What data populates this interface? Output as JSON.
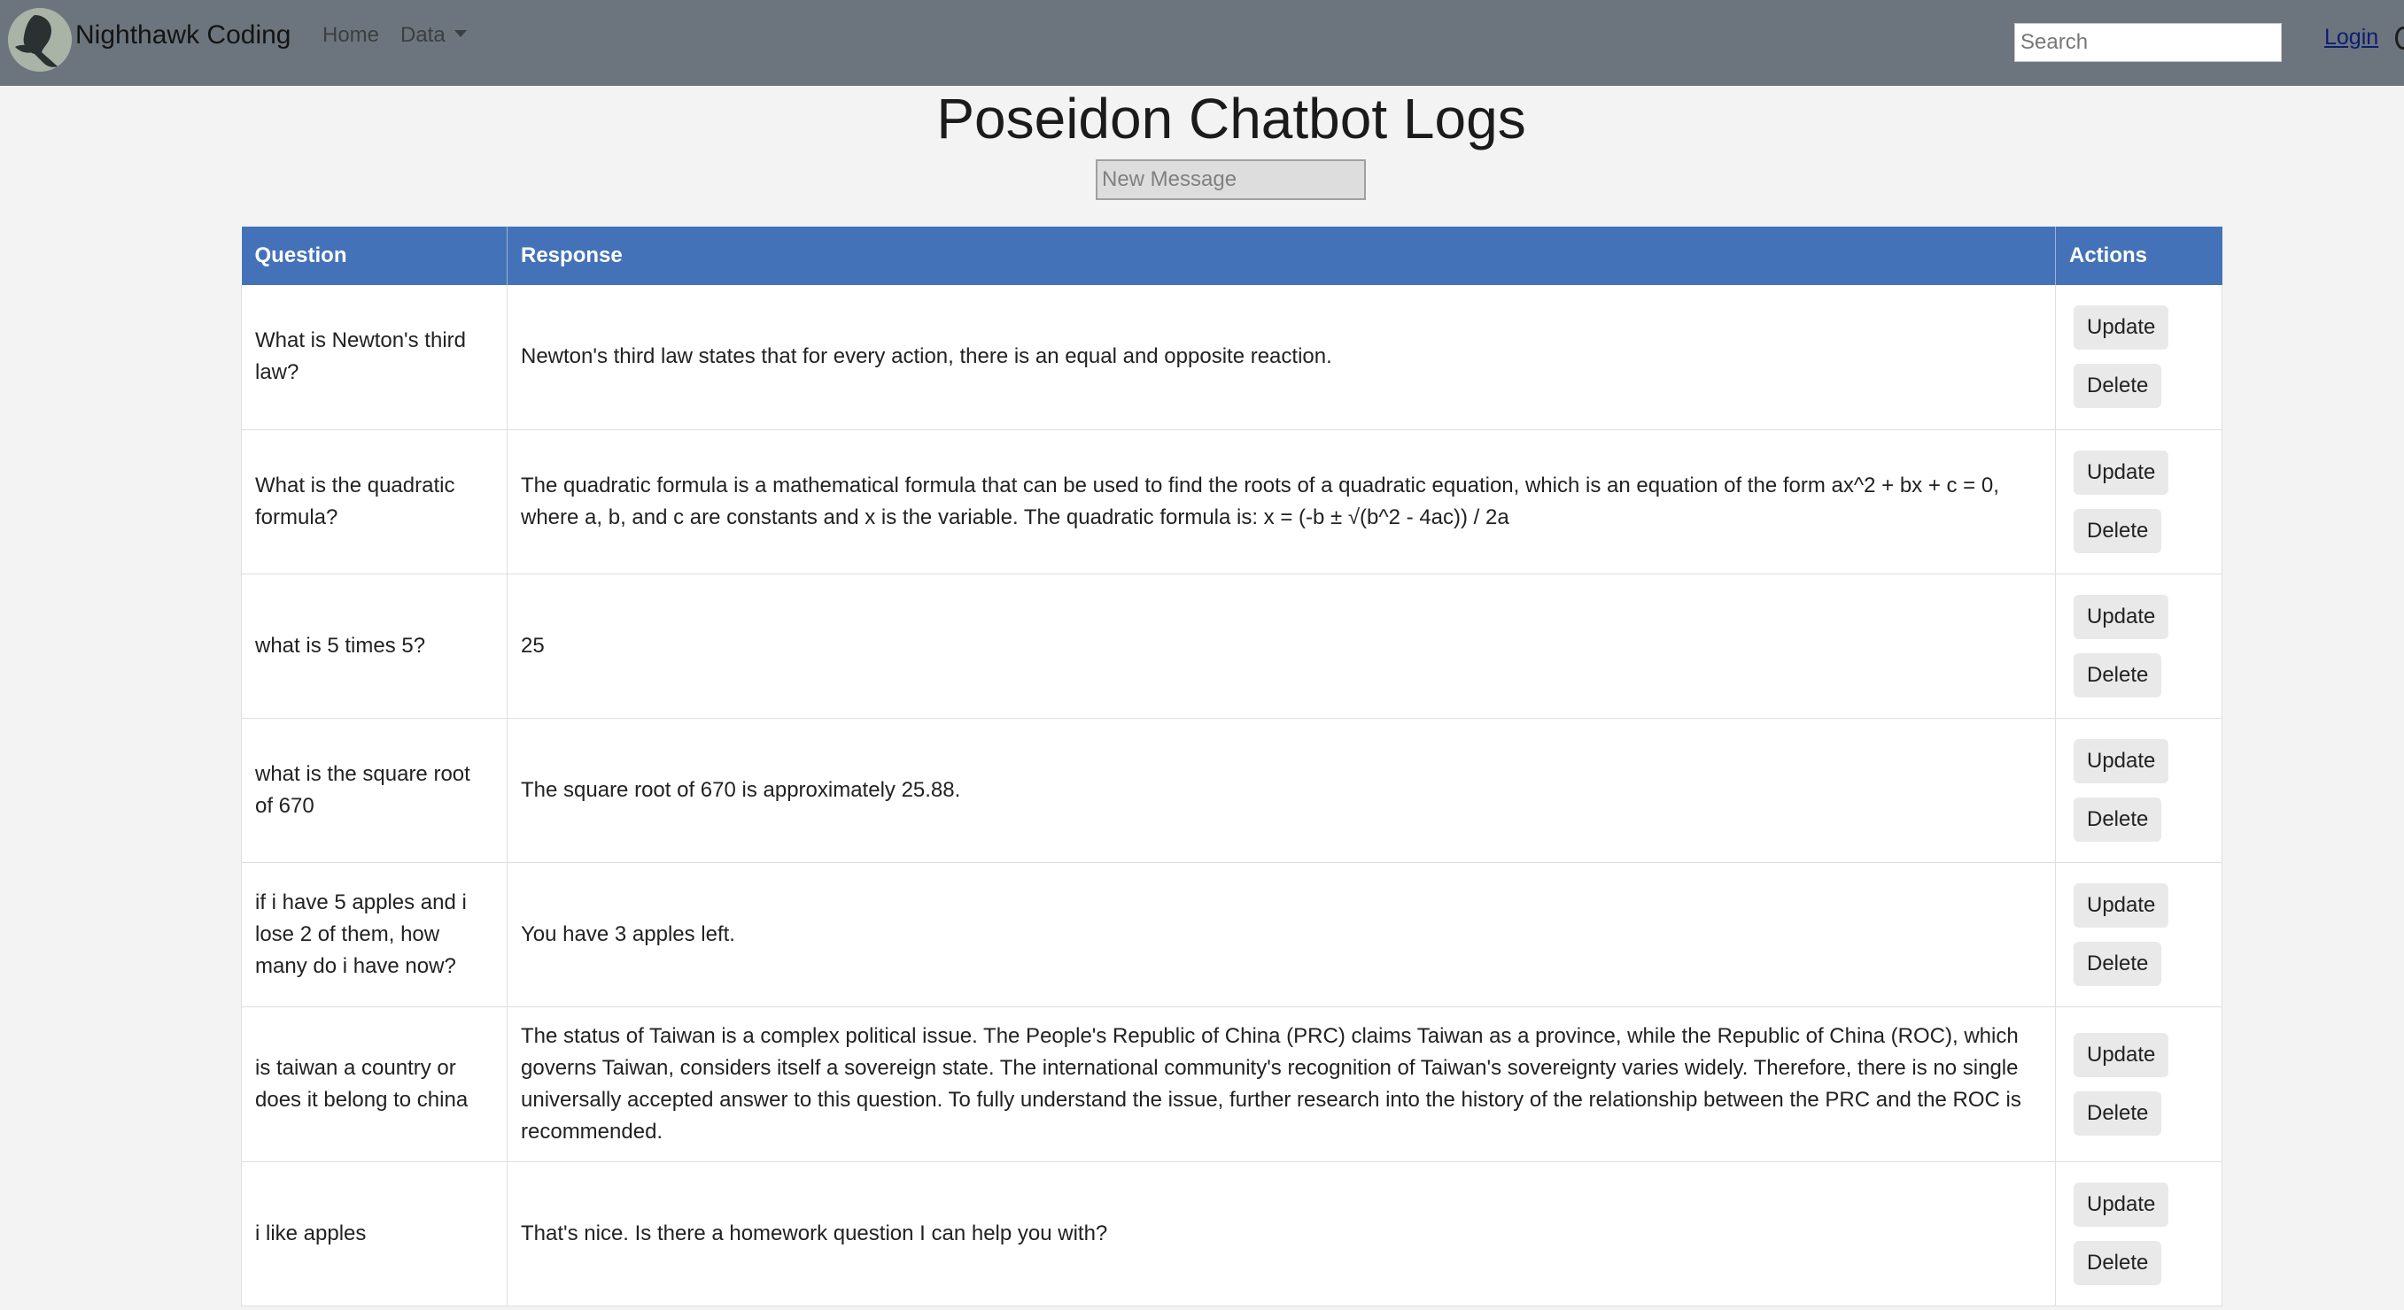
{
  "navbar": {
    "brand": "Nighthawk Coding",
    "home": "Home",
    "data": "Data",
    "search_placeholder": "Search",
    "login": "Login"
  },
  "page": {
    "title": "Poseidon Chatbot Logs",
    "new_message_placeholder": "New Message"
  },
  "table": {
    "headers": [
      "Question",
      "Response",
      "Actions"
    ],
    "update_label": "Update",
    "delete_label": "Delete",
    "rows": [
      {
        "question": "What is Newton's third law?",
        "response": "Newton's third law states that for every action, there is an equal and opposite reaction."
      },
      {
        "question": "What is the quadratic formula?",
        "response": "The quadratic formula is a mathematical formula that can be used to find the roots of a quadratic equation, which is an equation of the form ax^2 + bx + c = 0, where a, b, and c are constants and x is the variable. The quadratic formula is: x = (-b ± √(b^2 - 4ac)) / 2a"
      },
      {
        "question": "what is 5 times 5?",
        "response": "25"
      },
      {
        "question": "what is the square root of 670",
        "response": "The square root of 670 is approximately 25.88."
      },
      {
        "question": "if i have 5 apples and i lose 2 of them, how many do i have now?",
        "response": "You have 3 apples left."
      },
      {
        "question": "is taiwan a country or does it belong to china",
        "response": "The status of Taiwan is a complex political issue. The People's Republic of China (PRC) claims Taiwan as a province, while the Republic of China (ROC), which governs Taiwan, considers itself a sovereign state. The international community's recognition of Taiwan's sovereignty varies widely. Therefore, there is no single universally accepted answer to this question. To fully understand the issue, further research into the history of the relationship between the PRC and the ROC is recommended."
      },
      {
        "question": "i like apples",
        "response": "That's nice. Is there a homework question I can help you with?"
      }
    ]
  }
}
